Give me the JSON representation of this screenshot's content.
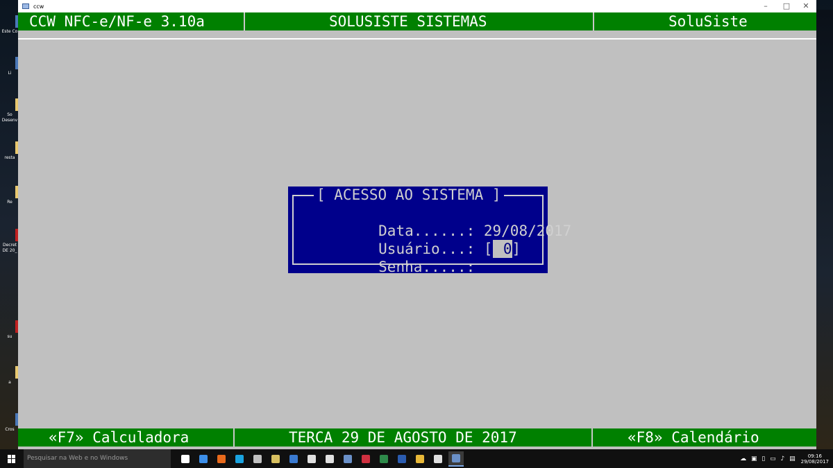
{
  "window": {
    "title": "ccw",
    "controls": {
      "minimize": "–",
      "maximize": "□",
      "close": "✕"
    }
  },
  "header": {
    "left": "CCW NFC-e/NF-e 3.10a",
    "center": "SOLUSISTE SISTEMAS",
    "right": "SoluSiste"
  },
  "login": {
    "title": "[ ACESSO AO SISTEMA ]",
    "date_label": "Data......: ",
    "date_value": "29/08/2017",
    "user_label": "Usuário...: [",
    "user_value": " 0",
    "user_close": "]",
    "password_label": "Senha.....:"
  },
  "footer": {
    "left": "«F7» Calculadora",
    "center": "TERCA 29 DE AGOSTO DE 2017",
    "right": "«F8» Calendário"
  },
  "desktop_icons": [
    {
      "label": "Este Co",
      "icon": "computer-icon"
    },
    {
      "label": "Li",
      "icon": "recycle-icon"
    },
    {
      "label": "So Desenv",
      "icon": "folder-icon"
    },
    {
      "label": "resta",
      "icon": "folder-icon"
    },
    {
      "label": "Re",
      "icon": "folder-icon"
    },
    {
      "label": "Decret DE 20_",
      "icon": "pdf-icon"
    },
    {
      "label": "su",
      "icon": "app-icon"
    },
    {
      "label": "a",
      "icon": "folder-icon"
    },
    {
      "label": "Cros",
      "icon": "app-icon"
    }
  ],
  "taskbar": {
    "search_placeholder": "Pesquisar na Web e no Windows",
    "apps": [
      {
        "name": "task-view-icon",
        "color": "#ffffff"
      },
      {
        "name": "edge-icon",
        "color": "#3c8ee8"
      },
      {
        "name": "firefox-icon",
        "color": "#e86a1c"
      },
      {
        "name": "skype-icon",
        "color": "#1aa3e0"
      },
      {
        "name": "terminal-icon",
        "color": "#c0c0c0"
      },
      {
        "name": "archive-icon",
        "color": "#d8c060"
      },
      {
        "name": "virtualbox-icon",
        "color": "#3a7ad0"
      },
      {
        "name": "cloud-icon",
        "color": "#e0e0e0"
      },
      {
        "name": "cloud-icon-2",
        "color": "#e0e0e0"
      },
      {
        "name": "ccw-icon",
        "color": "#6a90c8"
      },
      {
        "name": "pdf-reader-icon",
        "color": "#d03040"
      },
      {
        "name": "excel-icon",
        "color": "#2e8a4a"
      },
      {
        "name": "word-icon",
        "color": "#2b5cb0"
      },
      {
        "name": "explorer-icon",
        "color": "#e8b838"
      },
      {
        "name": "network-icon",
        "color": "#e0e0e0"
      },
      {
        "name": "ccw-active-icon",
        "color": "#6a90c8"
      }
    ],
    "tray": {
      "icons": "☁ ▣ ▯ ▭ ♪ ▤",
      "time": "09:16",
      "date": "29/08/2017"
    }
  },
  "colors": {
    "console_bg": "#c0c0c0",
    "bar_green": "#008000",
    "dialog_blue": "#00008b"
  }
}
